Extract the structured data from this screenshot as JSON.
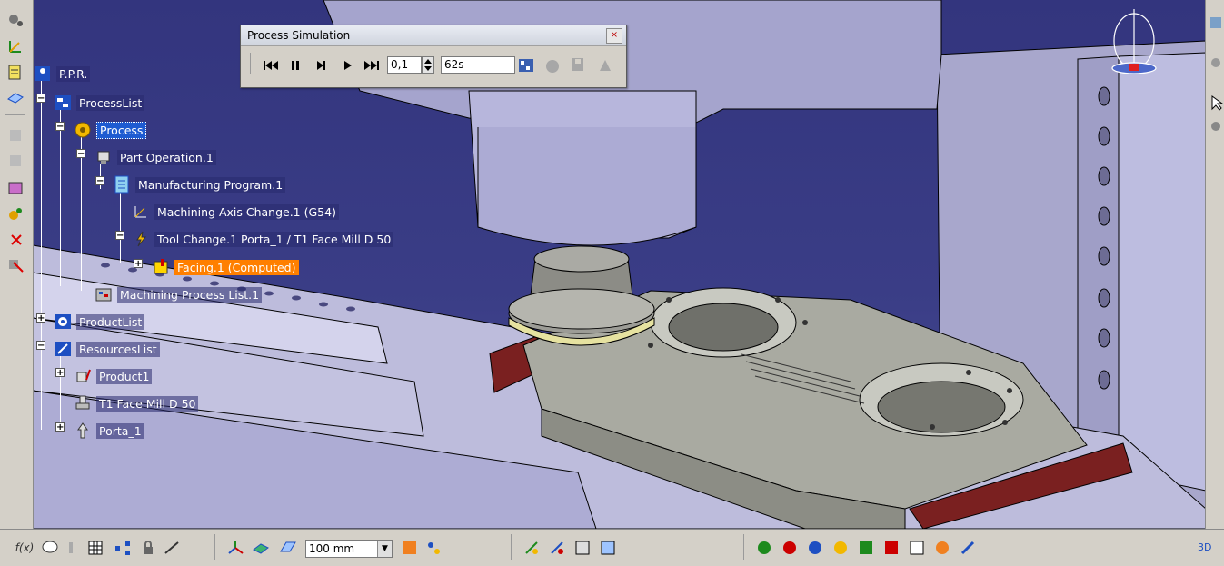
{
  "tree": {
    "ppr": "P.P.R.",
    "processlist": "ProcessList",
    "process": "Process",
    "part_operation": "Part Operation.1",
    "manufacturing_program": "Manufacturing Program.1",
    "axis_change": "Machining Axis Change.1 (G54)",
    "tool_change": "Tool Change.1  Porta_1 / T1 Face Mill D 50",
    "facing": "Facing.1 (Computed)",
    "machining_process_list": "Machining Process List.1",
    "productlist": "ProductList",
    "resourceslist": "ResourcesList",
    "product1": "Product1",
    "tool": "T1 Face Mill D 50",
    "porta": "Porta_1"
  },
  "simulation": {
    "title": "Process Simulation",
    "step_value": "0,1",
    "time_value": "62s",
    "close_glyph": "×"
  },
  "bottom_toolbar": {
    "fx_label": "f(x)",
    "unit_value": "100 mm"
  },
  "colors": {
    "background": "#33357e",
    "selected": "#1e5bd1",
    "computed": "#ff7f00",
    "toolbar": "#d4d0c8"
  }
}
